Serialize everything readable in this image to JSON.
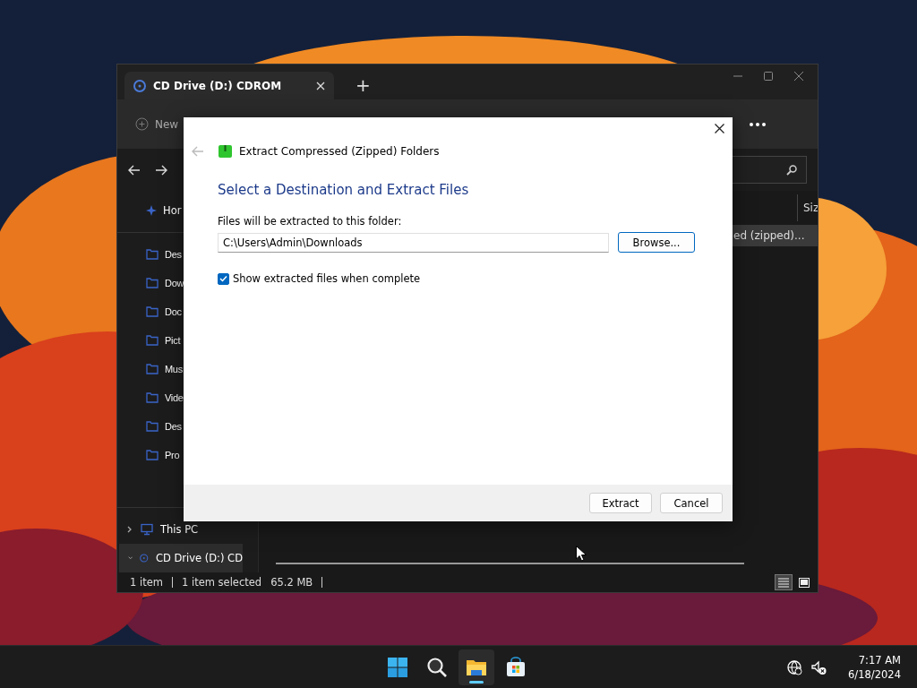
{
  "explorer": {
    "tab": {
      "title": "CD Drive (D:) CDROM",
      "selected": true
    },
    "new_tab": "+",
    "toolbar": {
      "new": "New"
    },
    "sidebar": {
      "home": {
        "label": "Hor"
      },
      "pinned": [
        {
          "label": "Des"
        },
        {
          "label": "Dow"
        },
        {
          "label": "Doc"
        },
        {
          "label": "Pict"
        },
        {
          "label": "Mus"
        },
        {
          "label": "Vide"
        },
        {
          "label": "Des"
        },
        {
          "label": "Pro"
        }
      ],
      "drives": [
        {
          "label": "This PC",
          "expanded": false,
          "selected": false
        },
        {
          "label": "CD Drive (D:) CD",
          "expanded": true,
          "selected": true
        }
      ]
    },
    "content": {
      "column": "Siz",
      "rows": [
        {
          "name": "ed (zipped)...",
          "selected": true
        }
      ]
    },
    "status_bar": {
      "count": "1 item",
      "selection": "1 item selected",
      "size": "65.2 MB"
    },
    "view_buttons": [
      {
        "kind": "details",
        "selected": true
      },
      {
        "kind": "tiles",
        "selected": false
      }
    ]
  },
  "dialog": {
    "title": "Extract Compressed (Zipped) Folders",
    "heading": "Select a Destination and Extract Files",
    "field_label": "Files will be extracted to this folder:",
    "path": "C:\\Users\\Admin\\Downloads",
    "browse": "Browse...",
    "checkbox": {
      "label": "Show extracted files when complete",
      "checked": true
    },
    "buttons": [
      "Extract",
      "Cancel"
    ]
  },
  "taskbar": {
    "apps": [
      {
        "kind": "start",
        "active": false
      },
      {
        "kind": "search",
        "active": false
      },
      {
        "kind": "explorer",
        "active": true
      },
      {
        "kind": "store",
        "active": false
      }
    ],
    "clock": {
      "time": "7:17 AM",
      "date": "6/18/2024"
    }
  }
}
